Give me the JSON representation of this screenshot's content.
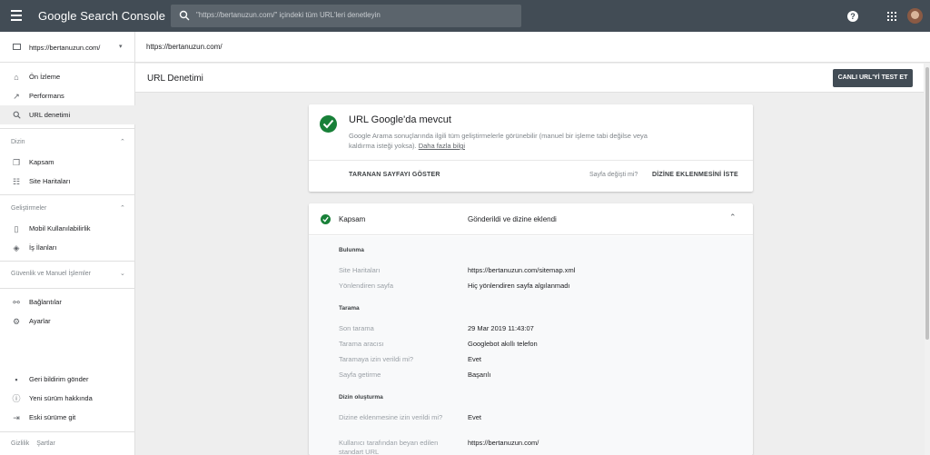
{
  "topbar": {
    "app_title": "Google Search Console",
    "search_placeholder": "\"https://bertanuzun.com/\" içindeki tüm URL'leri denetleyin"
  },
  "sidebar": {
    "property": "https://bertanuzun.com/",
    "items": [
      {
        "label": "Ön İzleme",
        "icon": "home-icon"
      },
      {
        "label": "Performans",
        "icon": "trend-icon"
      },
      {
        "label": "URL denetimi",
        "icon": "search-icon",
        "active": true
      }
    ],
    "sections": [
      {
        "title": "Dizin",
        "items": [
          {
            "label": "Kapsam",
            "icon": "copy-icon"
          },
          {
            "label": "Site Haritaları",
            "icon": "sitemap-icon"
          }
        ]
      },
      {
        "title": "Geliştirmeler",
        "items": [
          {
            "label": "Mobil Kullanılabilirlik",
            "icon": "phone-icon"
          },
          {
            "label": "İş İlanları",
            "icon": "layers-icon"
          }
        ]
      },
      {
        "title": "Güvenlik ve Manuel İşlemler",
        "items": []
      }
    ],
    "extra_items": [
      {
        "label": "Bağlantılar",
        "icon": "links-icon"
      },
      {
        "label": "Ayarlar",
        "icon": "gear-icon"
      }
    ],
    "bottom_items": [
      {
        "label": "Geri bildirim gönder",
        "icon": "feedback-icon"
      },
      {
        "label": "Yeni sürüm hakkında",
        "icon": "info-icon"
      },
      {
        "label": "Eski sürüme git",
        "icon": "exit-icon"
      }
    ],
    "footer": {
      "privacy": "Gizlilik",
      "terms": "Şartlar"
    }
  },
  "urlbar": {
    "url": "https://bertanuzun.com/"
  },
  "page": {
    "title": "URL Denetimi",
    "live_test_button": "CANLI URL'Yİ TEST ET"
  },
  "status_card": {
    "title": "URL Google'da mevcut",
    "description": "Google Arama sonuçlarında ilgili tüm geliştirmelerle görünebilir (manuel bir işleme tabi değilse veya kaldırma isteği yoksa).",
    "link": "Daha fazla bilgi",
    "show_crawled": "TARANAN SAYFAYI GÖSTER",
    "page_changed": "Sayfa değişti mi?",
    "request_index": "DİZİNE EKLENMESİNİ İSTE"
  },
  "coverage_card": {
    "title": "Kapsam",
    "status": "Gönderildi ve dizine eklendi",
    "sections": {
      "discovery": "Bulunma",
      "crawl": "Tarama",
      "indexing": "Dizin oluşturma"
    },
    "rows": {
      "sitemaps": {
        "label": "Site Haritaları",
        "value": "https://bertanuzun.com/sitemap.xml"
      },
      "referring": {
        "label": "Yönlendiren sayfa",
        "value": "Hiç yönlendiren sayfa algılanmadı"
      },
      "last_crawl": {
        "label": "Son tarama",
        "value": "29 Mar 2019 11:43:07"
      },
      "crawler": {
        "label": "Tarama aracısı",
        "value": "Googlebot akıllı telefon"
      },
      "crawl_allowed": {
        "label": "Taramaya izin verildi mi?",
        "value": "Evet"
      },
      "page_fetch": {
        "label": "Sayfa getirme",
        "value": "Başarılı"
      },
      "index_allowed": {
        "label": "Dizine eklenmesine izin verildi mi?",
        "value": "Evet"
      },
      "user_canonical": {
        "label": "Kullanıcı tarafından beyan edilen standart URL",
        "value": "https://bertanuzun.com/"
      }
    }
  },
  "colors": {
    "topbar": "#424c55",
    "success": "#188038"
  }
}
